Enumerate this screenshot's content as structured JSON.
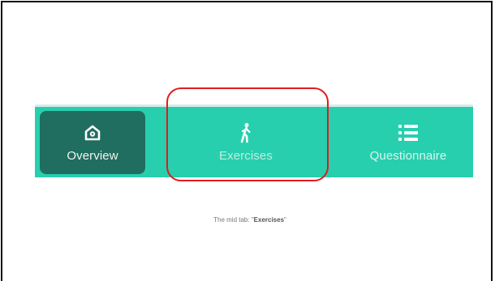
{
  "tabbar": {
    "tabs": [
      {
        "label": "Overview",
        "icon": "home-icon",
        "selected": true
      },
      {
        "label": "Exercises",
        "icon": "walking-person-icon",
        "selected": false
      },
      {
        "label": "Questionnaire",
        "icon": "list-icon",
        "selected": false
      }
    ]
  },
  "annotation": {
    "caption_prefix": "The mid tab: \"",
    "caption_highlight": "Exercises",
    "caption_suffix": "\"",
    "highlight_color": "#e11b1b"
  },
  "colors": {
    "tabbar_bg": "#27cfae",
    "selected_tab_bg": "#1f6e5f"
  }
}
